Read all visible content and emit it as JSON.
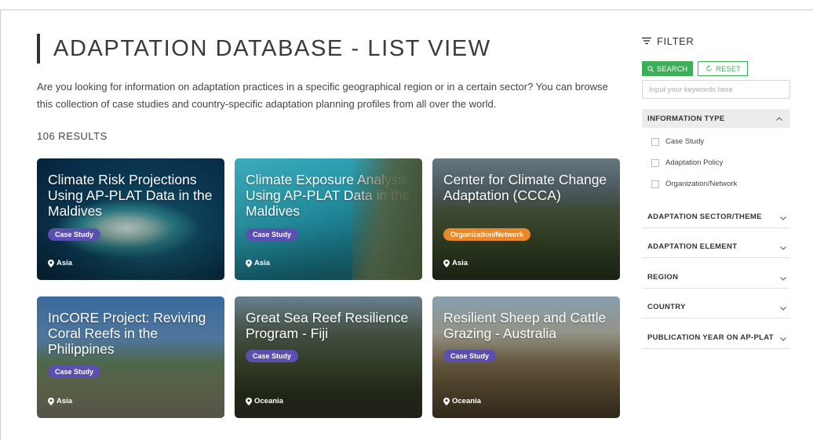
{
  "page": {
    "title": "ADAPTATION DATABASE - LIST VIEW",
    "intro": "Are you looking for information on adaptation practices in a specific geographical region or in a certain sector? You can browse this collection of case studies and country-specific adaptation planning profiles from all over the world.",
    "results": "106 RESULTS"
  },
  "cards": [
    {
      "title": "Climate Risk Projections Using AP-PLAT Data in the Maldives",
      "badge": "Case Study",
      "location": "Asia"
    },
    {
      "title": "Climate Exposure Analysis Using AP-PLAT Data in the Maldives",
      "badge": "Case Study",
      "location": "Asia"
    },
    {
      "title": "Center for Climate Change Adaptation (CCCA)",
      "badge": "Organization/Network",
      "location": "Asia"
    },
    {
      "title": "InCORE Project: Reviving Coral Reefs in the Philippines",
      "badge": "Case Study",
      "location": "Asia"
    },
    {
      "title": "Great Sea Reef Resilience Program - Fiji",
      "badge": "Case Study",
      "location": "Oceania"
    },
    {
      "title": "Resilient Sheep and Cattle Grazing - Australia",
      "badge": "Case Study",
      "location": "Oceania"
    }
  ],
  "sidebar": {
    "filter_label": "FILTER",
    "search_label": "SEARCH",
    "reset_label": "RESET",
    "search_placeholder": "Input your keywords here",
    "info_type": {
      "label": "INFORMATION TYPE",
      "options": [
        "Case Study",
        "Adaptation Policy",
        "Organization/Network"
      ]
    },
    "sections": [
      "ADAPTATION SECTOR/THEME",
      "ADAPTATION ELEMENT",
      "REGION",
      "COUNTRY",
      "PUBLICATION YEAR ON AP-PLAT"
    ]
  },
  "colors": {
    "accent_green": "#3fae5b",
    "badge_case_study": "#5b4fb0",
    "badge_org": "#e8882a"
  }
}
